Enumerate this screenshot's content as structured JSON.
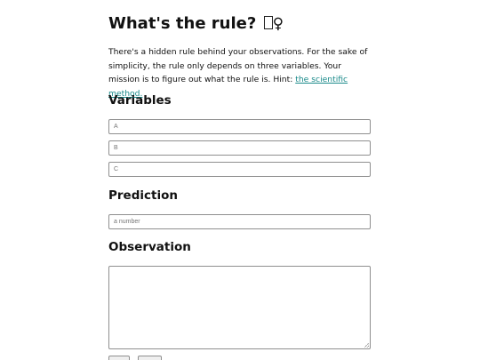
{
  "title": "What's the rule?",
  "title_emoji": "♀",
  "intro": {
    "text_before": "There's a hidden rule behind your observations. For the sake of simplicity, the rule only depends on three variables. Your mission is to figure out what the rule is. Hint: ",
    "link_text": "the scientific method."
  },
  "variables": {
    "heading": "Variables",
    "fields": [
      {
        "placeholder": "A"
      },
      {
        "placeholder": "B"
      },
      {
        "placeholder": "C"
      }
    ]
  },
  "prediction": {
    "heading": "Prediction",
    "placeholder": "a number"
  },
  "observation": {
    "heading": "Observation"
  },
  "colors": {
    "link": "#1a8a8a",
    "border": "#8f8f8f"
  }
}
